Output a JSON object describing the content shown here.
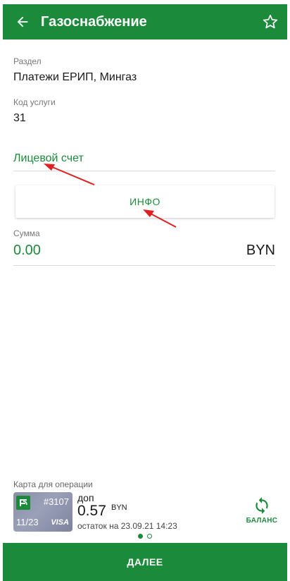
{
  "header": {
    "title": "Газоснабжение",
    "back_icon": "arrow-left-icon",
    "favorite_icon": "star-outline-icon"
  },
  "section": {
    "label": "Раздел",
    "value": "Платежи ЕРИП, Мингаз"
  },
  "service_code": {
    "label": "Код услуги",
    "value": "31"
  },
  "account": {
    "placeholder": "Лицевой счет"
  },
  "info_button": {
    "label": "ИНФО"
  },
  "amount": {
    "label": "Сумма",
    "value": "0.00",
    "currency": "BYN"
  },
  "card": {
    "section_label": "Карта для операции",
    "number": "#3107",
    "expiry": "11/23",
    "brand": "VISA",
    "name": "доп",
    "balance": "0.57",
    "balance_currency": "BYN",
    "remainder_text": "остаток на 23.09.21 14:23",
    "balance_button_label": "БАЛАНС",
    "pager": {
      "count": 2,
      "active": 1
    }
  },
  "next_button": {
    "label": "ДАЛЕЕ"
  },
  "colors": {
    "primary": "#1b8a3a",
    "annotation_arrow": "#e02020"
  }
}
